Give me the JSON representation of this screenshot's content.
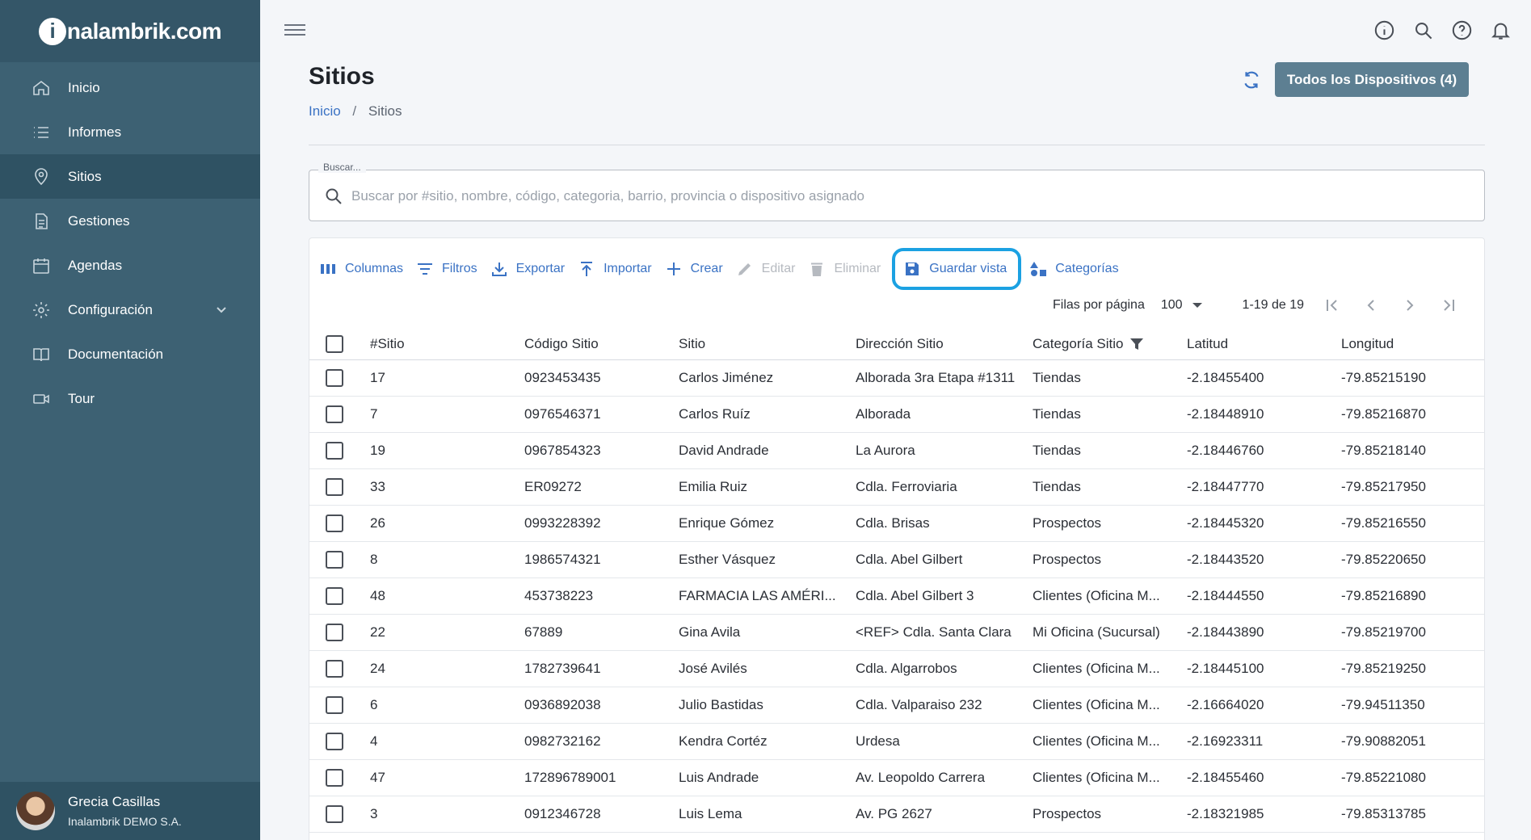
{
  "brand": {
    "logo_i": "i",
    "logo_rest": "nalambrik.com"
  },
  "sidebar": {
    "items": [
      {
        "label": "Inicio",
        "icon": "home-icon"
      },
      {
        "label": "Informes",
        "icon": "list-icon"
      },
      {
        "label": "Sitios",
        "icon": "location-pin-icon",
        "active": true
      },
      {
        "label": "Gestiones",
        "icon": "document-icon"
      },
      {
        "label": "Agendas",
        "icon": "calendar-icon"
      },
      {
        "label": "Configuración",
        "icon": "gear-icon",
        "expandable": true
      },
      {
        "label": "Documentación",
        "icon": "book-icon"
      },
      {
        "label": "Tour",
        "icon": "video-camera-icon"
      }
    ]
  },
  "user": {
    "name": "Grecia Casillas",
    "org": "Inalambrik DEMO S.A."
  },
  "topbar": {
    "icons": [
      "info-icon",
      "search-icon",
      "help-icon",
      "bell-icon"
    ]
  },
  "header": {
    "title": "Sitios",
    "breadcrumb": {
      "home": "Inicio",
      "separator": "/",
      "current": "Sitios"
    },
    "devices_button": "Todos los Dispositivos (4)"
  },
  "search": {
    "label": "Buscar...",
    "placeholder": "Buscar por #sitio, nombre, código, categoria, barrio, provincia o dispositivo asignado",
    "value": ""
  },
  "toolbar": {
    "columns": "Columnas",
    "filters": "Filtros",
    "export": "Exportar",
    "import": "Importar",
    "create": "Crear",
    "edit": "Editar",
    "delete": "Eliminar",
    "save_view": "Guardar vista",
    "categories": "Categorías"
  },
  "pagination": {
    "rows_label": "Filas por página",
    "rows_value": "100",
    "range": "1-19 de 19"
  },
  "table": {
    "columns": [
      "#Sitio",
      "Código Sitio",
      "Sitio",
      "Dirección Sitio",
      "Categoría Sitio",
      "Latitud",
      "Longitud"
    ],
    "rows": [
      [
        "17",
        "0923453435",
        "Carlos Jiménez",
        "Alborada 3ra Etapa #1311",
        "Tiendas",
        "-2.18455400",
        "-79.85215190"
      ],
      [
        "7",
        "0976546371",
        "Carlos Ruíz",
        "Alborada",
        "Tiendas",
        "-2.18448910",
        "-79.85216870"
      ],
      [
        "19",
        "0967854323",
        "David Andrade",
        "La Aurora",
        "Tiendas",
        "-2.18446760",
        "-79.85218140"
      ],
      [
        "33",
        "ER09272",
        "Emilia Ruiz",
        "Cdla. Ferroviaria",
        "Tiendas",
        "-2.18447770",
        "-79.85217950"
      ],
      [
        "26",
        "0993228392",
        "Enrique Gómez",
        "Cdla. Brisas",
        "Prospectos",
        "-2.18445320",
        "-79.85216550"
      ],
      [
        "8",
        "1986574321",
        "Esther Vásquez",
        "Cdla. Abel Gilbert",
        "Prospectos",
        "-2.18443520",
        "-79.85220650"
      ],
      [
        "48",
        "453738223",
        "FARMACIA LAS AMÉRI...",
        "Cdla. Abel Gilbert 3",
        "Clientes (Oficina M...",
        "-2.18444550",
        "-79.85216890"
      ],
      [
        "22",
        "67889",
        "Gina Avila",
        "<REF> Cdla. Santa Clara",
        "Mi Oficina (Sucursal)",
        "-2.18443890",
        "-79.85219700"
      ],
      [
        "24",
        "1782739641",
        "José Avilés",
        "Cdla. Algarrobos",
        "Clientes (Oficina M...",
        "-2.18445100",
        "-79.85219250"
      ],
      [
        "6",
        "0936892038",
        "Julio Bastidas",
        "Cdla. Valparaiso 232",
        "Clientes (Oficina M...",
        "-2.16664020",
        "-79.94511350"
      ],
      [
        "4",
        "0982732162",
        "Kendra Cortéz",
        "Urdesa",
        "Clientes (Oficina M...",
        "-2.16923311",
        "-79.90882051"
      ],
      [
        "47",
        "172896789001",
        "Luis Andrade",
        "Av. Leopoldo Carrera",
        "Clientes (Oficina M...",
        "-2.18455460",
        "-79.85221080"
      ],
      [
        "3",
        "0912346728",
        "Luis Lema",
        "Av. PG 2627",
        "Prospectos",
        "-2.18321985",
        "-79.85313785"
      ]
    ]
  },
  "colors": {
    "sidebar": "#3d6173",
    "accent": "#3a72c4",
    "highlight": "#1ba1e2"
  }
}
